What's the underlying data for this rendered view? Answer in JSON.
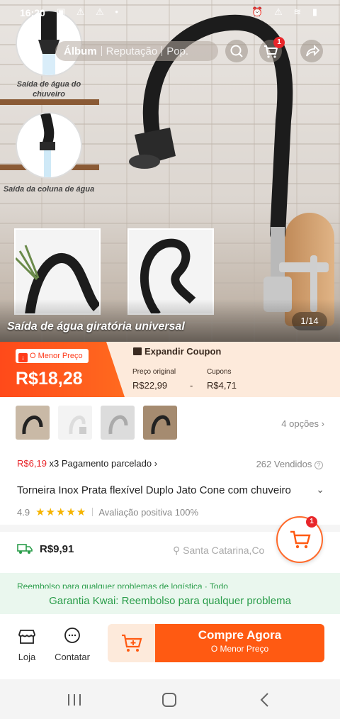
{
  "status_bar": {
    "time": "16:20",
    "left_icons": "▣ ⚠ ⚠ •",
    "right_icons": "⏰ ⚠ ≋ ▮"
  },
  "top_nav": {
    "tabs": [
      {
        "label": "Álbum",
        "active": true
      },
      {
        "label": "Reputação",
        "active": false
      },
      {
        "label": "Pop.",
        "active": false
      }
    ],
    "cart_badge": "1"
  },
  "hero": {
    "bubble_1_caption": "Saída de água do chuveiro",
    "bubble_2_caption": "Saída da coluna de água",
    "caption": "Saída de água giratória universal",
    "counter": "1/14"
  },
  "price": {
    "lowest_tag": "O Menor Preço",
    "current": "R$18,28",
    "coupon_header": "Expandir Coupon",
    "original_label": "Preço original",
    "original_value": "R$22,99",
    "minus": "-",
    "coupons_label": "Cupons",
    "coupons_value": "R$4,71"
  },
  "variants": {
    "count": 4,
    "options_label": "4 opções"
  },
  "installments": {
    "amount": "R$6,19",
    "text": "x3 Pagamento parcelado"
  },
  "sold": "262 Vendidos",
  "product": {
    "title": "Torneira Inox Prata flexível Duplo Jato Cone com chuveiro",
    "rating": "4.9",
    "stars": "★★★★★",
    "positive": "Avaliação positiva 100%"
  },
  "shipping": {
    "price": "R$9,91",
    "location": "Santa Catarina,Co"
  },
  "float_cart_badge": "1",
  "refund_strip": "Reembolso para qualquer problemas de logística · Todo",
  "guarantee": "Garantia Kwai: Reembolso para qualquer problema",
  "actions": {
    "store": "Loja",
    "contact": "Contatar",
    "buy_now": "Compre Agora",
    "buy_now_sub": "O Menor Preço"
  },
  "colors": {
    "accent": "#ff5a12",
    "badge": "#e8262a",
    "green": "#2a9d4a",
    "star": "#f5b400"
  }
}
